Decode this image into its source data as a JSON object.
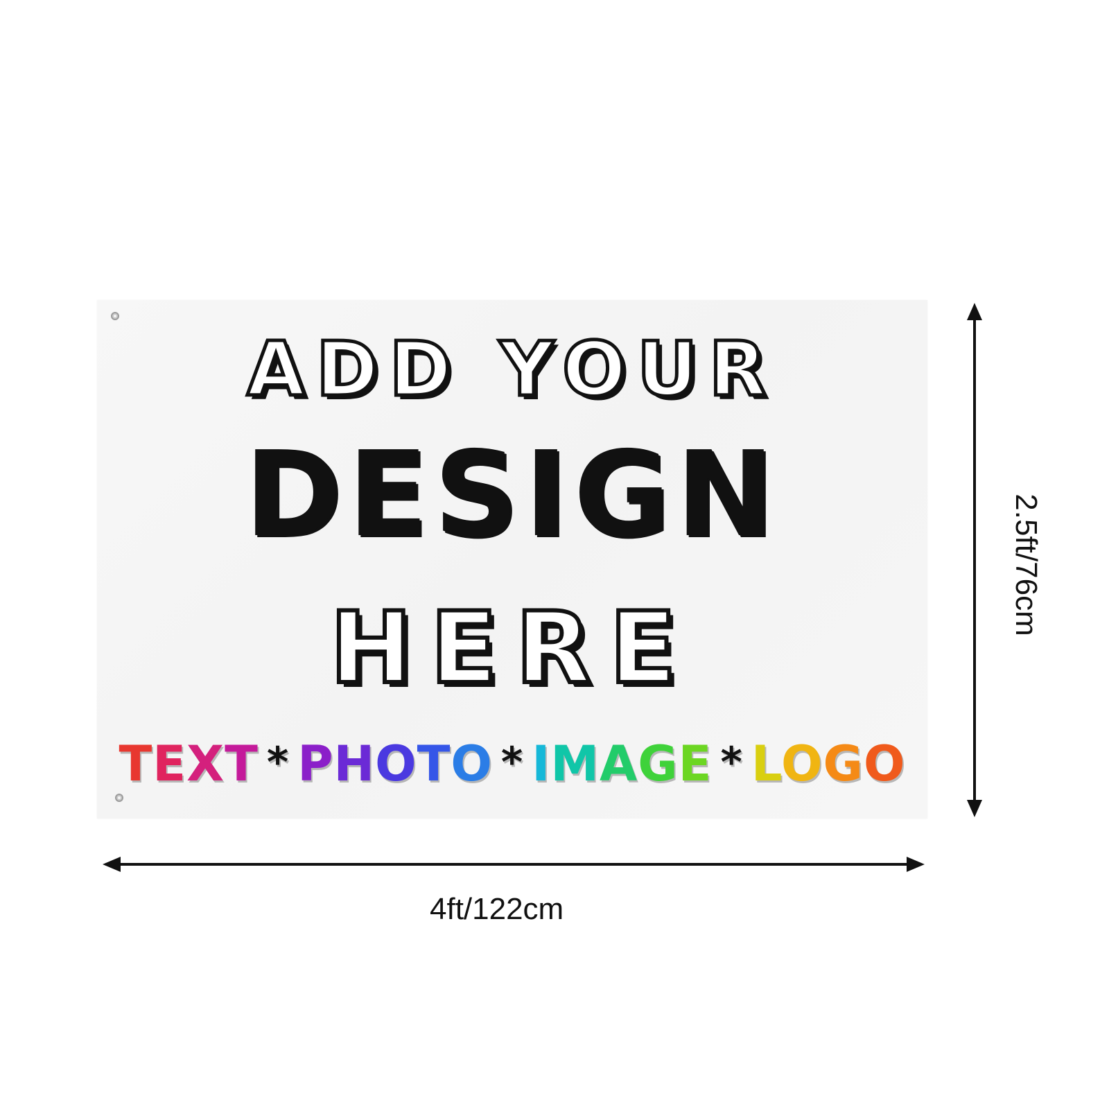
{
  "flag": {
    "line1": "ADD YOUR",
    "line2": "DESIGN",
    "line3": "HERE",
    "line4": {
      "words": [
        "TEXT",
        "PHOTO",
        "IMAGE",
        "LOGO"
      ],
      "separator": "*",
      "colors": {
        "text": [
          "#e8372f",
          "#e0245e",
          "#d4207d",
          "#c41a9a"
        ],
        "photo": [
          "#8b1fc9",
          "#6b2ad6",
          "#4a39e0",
          "#3556e8",
          "#2b7de6"
        ],
        "image": [
          "#16b8d8",
          "#10c6a8",
          "#22cc6a",
          "#3fd23a",
          "#6cd622"
        ],
        "logo": [
          "#d9cf10",
          "#f0b512",
          "#f58a16",
          "#f05a1c"
        ]
      }
    }
  },
  "dimensions": {
    "width_label": "4ft/122cm",
    "height_label": "2.5ft/76cm"
  }
}
